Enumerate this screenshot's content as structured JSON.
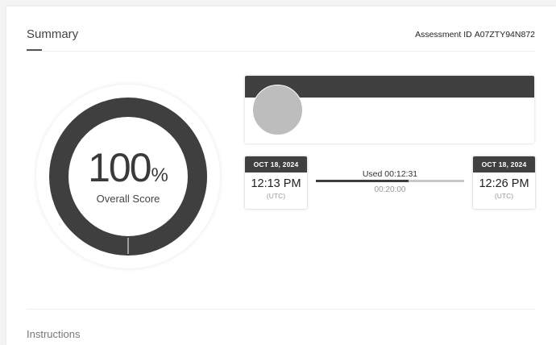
{
  "header": {
    "title": "Summary",
    "assessment_label": "Assessment ID",
    "assessment_id": "A07ZTY94N872"
  },
  "score": {
    "value": "100",
    "unit": "%",
    "label": "Overall Score",
    "fraction": 1.0
  },
  "timeline": {
    "start": {
      "date": "OCT 18, 2024",
      "time": "12:13 PM",
      "tz": "(UTC)"
    },
    "end": {
      "date": "OCT 18, 2024",
      "time": "12:26 PM",
      "tz": "(UTC)"
    },
    "used_text": "Used 00:12:31",
    "limit_text": "00:20:00",
    "used_fraction": 0.626
  },
  "sections": {
    "next_title": "Instructions"
  },
  "colors": {
    "dark": "#404040",
    "ring": "#3f3f3f",
    "avatar": "#bdbdbd"
  }
}
